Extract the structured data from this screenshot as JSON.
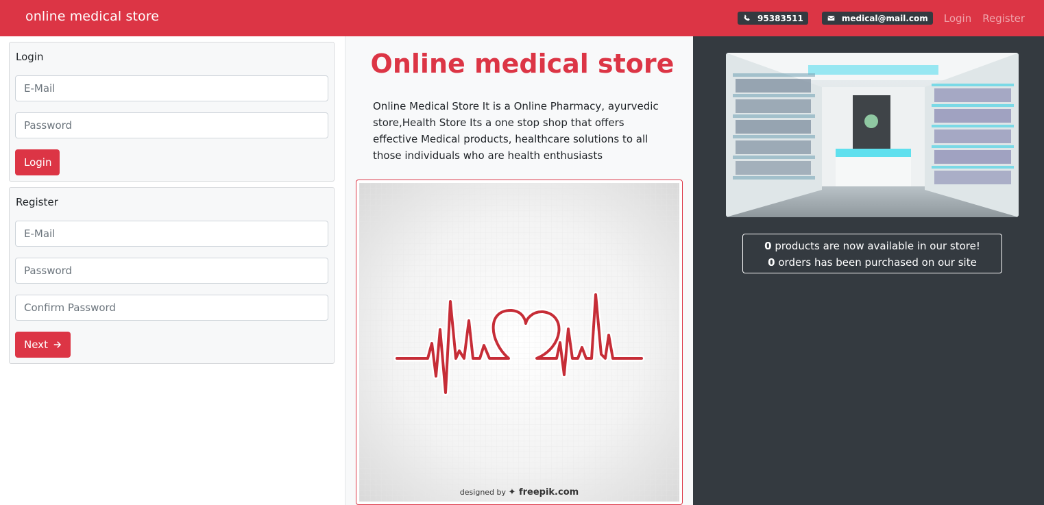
{
  "navbar": {
    "brand": "online medical store",
    "phone": "95383511",
    "email": "medical@mail.com",
    "login_link": "Login",
    "register_link": "Register",
    "phone_icon": "phone-icon",
    "mail_icon": "envelope-icon"
  },
  "login_card": {
    "title": "Login",
    "email_placeholder": "E-Mail",
    "password_placeholder": "Password",
    "button": "Login"
  },
  "register_card": {
    "title": "Register",
    "email_placeholder": "E-Mail",
    "password_placeholder": "Password",
    "confirm_placeholder": "Confirm Password",
    "button": "Next",
    "button_icon": "arrow-right-icon"
  },
  "main": {
    "title": "Online medical store",
    "description": "Online Medical Store It is a Online Pharmacy, ayurvedic store,Health Store Its a one stop shop that offers effective Medical products, healthcare solutions to all those individuals who are health enthusiasts",
    "image_credit_prefix": "designed by",
    "image_credit_brand": "freepik.com"
  },
  "stats": {
    "products_count": "0",
    "products_text": " products are now available in our store!",
    "orders_count": "0",
    "orders_text": " orders has been purchased on our site"
  },
  "colors": {
    "primary": "#dc3545",
    "dark": "#343a40",
    "light": "#f8f9fa"
  }
}
